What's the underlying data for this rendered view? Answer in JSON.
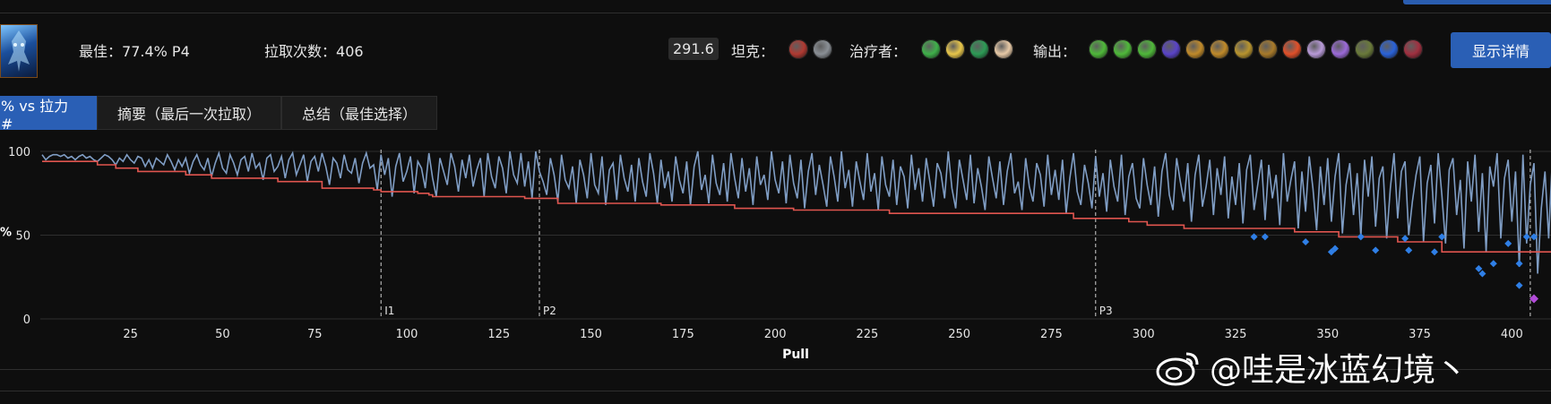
{
  "header": {
    "best_label": "最佳：",
    "best_value": "77.4% P4",
    "pulls_label": "拉取次数：",
    "pulls_value": "406",
    "score": "291.6",
    "tank_label": "坦克：",
    "healer_label": "治疗者：",
    "dps_label": "输出：",
    "detail_button": "显示详情",
    "tank_icons": [
      {
        "name": "tank-spec-icon-1",
        "color": "#b03a32"
      },
      {
        "name": "tank-spec-icon-2",
        "color": "#8a8f95"
      }
    ],
    "healer_icons": [
      {
        "name": "healer-spec-icon-1",
        "color": "#3fb04a"
      },
      {
        "name": "healer-spec-icon-2",
        "color": "#e8c64a"
      },
      {
        "name": "healer-spec-icon-3",
        "color": "#2d9a55"
      },
      {
        "name": "healer-spec-icon-4",
        "color": "#e7c9a6"
      }
    ],
    "dps_icons": [
      {
        "name": "dps-spec-icon-1",
        "color": "#4fb83a"
      },
      {
        "name": "dps-spec-icon-2",
        "color": "#4fb83a"
      },
      {
        "name": "dps-spec-icon-3",
        "color": "#4fb83a"
      },
      {
        "name": "dps-spec-icon-4",
        "color": "#5a44c8"
      },
      {
        "name": "dps-spec-icon-5",
        "color": "#c08a2a"
      },
      {
        "name": "dps-spec-icon-6",
        "color": "#c08a2a"
      },
      {
        "name": "dps-spec-icon-7",
        "color": "#b8942e"
      },
      {
        "name": "dps-spec-icon-8",
        "color": "#a87a2a"
      },
      {
        "name": "dps-spec-icon-9",
        "color": "#e0502a"
      },
      {
        "name": "dps-spec-icon-10",
        "color": "#b89ad8"
      },
      {
        "name": "dps-spec-icon-11",
        "color": "#9b6ad8"
      },
      {
        "name": "dps-spec-icon-12",
        "color": "#6a7a3a"
      },
      {
        "name": "dps-spec-icon-13",
        "color": "#2a62d8"
      },
      {
        "name": "dps-spec-icon-14",
        "color": "#a03040"
      }
    ]
  },
  "tabs": [
    {
      "label": "% vs 拉力 #",
      "active": true
    },
    {
      "label": "摘要（最后一次拉取）",
      "active": false
    },
    {
      "label": "总结（最佳选择）",
      "active": false
    }
  ],
  "watermark": "@哇是冰蓝幻境丶",
  "colors": {
    "accent": "#2a5fb5",
    "pull_line": "#7f9dc4",
    "best_line": "#e0554f",
    "marker_blue": "#2f7fe6",
    "marker_purple": "#b24bd8"
  },
  "chart_data": {
    "type": "line",
    "xlabel": "Pull",
    "ylabel": "%",
    "xlim": [
      1,
      406
    ],
    "ylim": [
      0,
      100
    ],
    "xticks": [
      25,
      50,
      75,
      100,
      125,
      150,
      175,
      200,
      225,
      250,
      275,
      300,
      325,
      350,
      375,
      400
    ],
    "yticks": [
      0,
      50,
      100
    ],
    "grid": "horizontal",
    "phase_markers": [
      {
        "label": "I1",
        "x": 93
      },
      {
        "label": "P2",
        "x": 136
      },
      {
        "label": "P3",
        "x": 287
      },
      {
        "label": "",
        "x": 405
      }
    ],
    "series": [
      {
        "values": [
          98,
          95,
          97,
          98,
          98,
          97,
          98,
          96,
          97,
          95,
          97,
          98,
          96,
          97,
          95,
          94,
          96,
          98,
          97,
          95,
          92,
          96,
          94,
          98,
          95,
          93,
          97,
          96,
          91,
          95,
          90,
          96,
          94,
          92,
          98,
          94,
          89,
          95,
          91,
          96,
          87,
          94,
          98,
          92,
          89,
          96,
          85,
          93,
          99,
          90,
          87,
          98,
          93,
          86,
          95,
          97,
          88,
          99,
          90,
          93,
          83,
          96,
          98,
          88,
          91,
          97,
          84,
          95,
          99,
          86,
          92,
          98,
          82,
          94,
          97,
          88,
          99,
          91,
          80,
          96,
          93,
          84,
          98,
          89,
          87,
          96,
          81,
          93,
          99,
          90,
          92,
          77,
          98,
          86,
          96,
          73,
          91,
          99,
          82,
          88,
          97,
          75,
          94,
          90,
          78,
          99,
          84,
          73,
          96,
          88,
          80,
          99,
          91,
          76,
          95,
          84,
          98,
          79,
          89,
          96,
          73,
          99,
          85,
          78,
          97,
          90,
          75,
          100,
          86,
          81,
          99,
          79,
          94,
          72,
          100,
          88,
          82,
          74,
          96,
          86,
          70,
          98,
          83,
          78,
          91,
          69,
          95,
          86,
          72,
          99,
          80,
          75,
          97,
          68,
          89,
          93,
          71,
          98,
          84,
          76,
          92,
          70,
          96,
          82,
          73,
          99,
          87,
          69,
          95,
          78,
          88,
          70,
          97,
          83,
          75,
          94,
          68,
          91,
          100,
          77,
          86,
          69,
          98,
          81,
          74,
          93,
          70,
          99,
          84,
          72,
          96,
          76,
          90,
          68,
          97,
          80,
          86,
          71,
          100,
          83,
          75,
          94,
          69,
          98,
          81,
          72,
          95,
          66,
          88,
          99,
          74,
          92,
          80,
          67,
          97,
          85,
          70,
          100,
          78,
          89,
          67,
          94,
          82,
          71,
          99,
          76,
          87,
          65,
          97,
          80,
          73,
          95,
          68,
          91,
          85,
          66,
          98,
          77,
          90,
          70,
          96,
          82,
          67,
          93,
          87,
          72,
          100,
          78,
          66,
          95,
          83,
          71,
          98,
          69,
          90,
          79,
          65,
          97,
          84,
          72,
          94,
          68,
          88,
          99,
          75,
          82,
          65,
          96,
          79,
          70,
          93,
          86,
          67,
          98,
          74,
          89,
          71,
          95,
          63,
          84,
          99,
          76,
          68,
          92,
          81,
          66,
          97,
          73,
          87,
          64,
          95,
          79,
          70,
          98,
          62,
          85,
          93,
          72,
          66,
          96,
          80,
          68,
          91,
          61,
          88,
          99,
          74,
          65,
          96,
          82,
          70,
          93,
          58,
          86,
          98,
          67,
          79,
          95,
          62,
          90,
          74,
          97,
          60,
          85,
          68,
          93,
          57,
          89,
          98,
          65,
          80,
          95,
          59,
          92,
          72,
          86,
          56,
          99,
          70,
          83,
          94,
          54,
          88,
          64,
          97,
          78,
          53,
          91,
          68,
          96,
          58,
          85,
          99,
          51,
          80,
          93,
          62,
          87,
          49,
          95,
          73,
          97,
          55,
          84,
          91,
          48,
          78,
          99,
          60,
          88,
          94,
          50,
          70,
          86,
          97,
          46,
          81,
          92,
          57,
          99,
          74,
          45,
          89,
          96,
          62,
          83,
          42,
          94,
          70,
          98,
          52,
          87,
          40,
          91,
          79,
          99,
          48,
          84,
          95,
          58,
          88,
          31,
          98,
          45,
          80,
          93,
          27,
          66,
          88,
          48,
          97,
          35,
          72,
          86,
          44,
          99,
          20,
          50,
          49,
          12,
          12,
          20,
          50,
          49,
          13,
          12
        ]
      },
      {
        "values": [
          94,
          94,
          94,
          94,
          94,
          94,
          94,
          94,
          94,
          94,
          94,
          94,
          94,
          94,
          94,
          92,
          92,
          92,
          92,
          92,
          90,
          90,
          90,
          90,
          90,
          90,
          88,
          88,
          88,
          88,
          88,
          88,
          88,
          88,
          88,
          88,
          88,
          88,
          88,
          86,
          86,
          86,
          86,
          86,
          86,
          86,
          84,
          84,
          84,
          84,
          84,
          84,
          84,
          84,
          84,
          84,
          84,
          84,
          84,
          84,
          84,
          84,
          84,
          84,
          82,
          82,
          82,
          82,
          82,
          82,
          82,
          82,
          82,
          82,
          82,
          82,
          78,
          78,
          78,
          78,
          78,
          78,
          78,
          78,
          78,
          78,
          78,
          78,
          78,
          78,
          77,
          77,
          76,
          76,
          76,
          76,
          76,
          76,
          76,
          76,
          76,
          76,
          75,
          75,
          75,
          74,
          73,
          73,
          73,
          73,
          73,
          73,
          73,
          73,
          73,
          73,
          73,
          73,
          73,
          73,
          73,
          73,
          73,
          73,
          73,
          73,
          73,
          73,
          73,
          73,
          73,
          72,
          72,
          72,
          72,
          72,
          72,
          72,
          72,
          72,
          69,
          69,
          69,
          69,
          69,
          69,
          69,
          69,
          69,
          69,
          69,
          69,
          69,
          69,
          69,
          69,
          69,
          69,
          69,
          69,
          69,
          69,
          69,
          69,
          69,
          69,
          69,
          69,
          68,
          68,
          68,
          68,
          68,
          68,
          68,
          68,
          68,
          68,
          68,
          68,
          68,
          68,
          68,
          68,
          68,
          68,
          68,
          68,
          66,
          66,
          66,
          66,
          66,
          66,
          66,
          66,
          66,
          66,
          66,
          66,
          66,
          66,
          66,
          66,
          65,
          65,
          65,
          65,
          65,
          65,
          65,
          65,
          65,
          65,
          65,
          65,
          65,
          65,
          65,
          65,
          65,
          65,
          65,
          65,
          65,
          65,
          65,
          65,
          65,
          65,
          63,
          63,
          63,
          63,
          63,
          63,
          63,
          63,
          63,
          63,
          63,
          63,
          63,
          63,
          63,
          63,
          63,
          63,
          63,
          63,
          63,
          63,
          63,
          63,
          63,
          63,
          63,
          63,
          63,
          63,
          63,
          63,
          63,
          63,
          63,
          63,
          63,
          63,
          63,
          63,
          63,
          63,
          63,
          63,
          63,
          63,
          63,
          63,
          63,
          63,
          60,
          60,
          60,
          60,
          60,
          60,
          60,
          60,
          60,
          60,
          60,
          60,
          60,
          60,
          60,
          58,
          58,
          58,
          58,
          58,
          56,
          56,
          56,
          56,
          56,
          56,
          56,
          56,
          56,
          56,
          54,
          54,
          54,
          54,
          54,
          54,
          54,
          54,
          54,
          54,
          54,
          54,
          54,
          54,
          54,
          54,
          54,
          54,
          54,
          54,
          54,
          54,
          54,
          54,
          54,
          54,
          54,
          54,
          54,
          54,
          52,
          52,
          52,
          52,
          52,
          52,
          52,
          52,
          52,
          52,
          52,
          52,
          49,
          49,
          49,
          49,
          49,
          49,
          49,
          49,
          49,
          49,
          49,
          49,
          49,
          49,
          49,
          49,
          46,
          46,
          46,
          46,
          46,
          46,
          46,
          46,
          46,
          46,
          46,
          46,
          40,
          40,
          40,
          40,
          40,
          40,
          40,
          40,
          40,
          40,
          40,
          40,
          40,
          40,
          40,
          40,
          40,
          40,
          40,
          40,
          40,
          40,
          40,
          40,
          40,
          40,
          40,
          40,
          40,
          40,
          40,
          40,
          40,
          40,
          40,
          40,
          40,
          40,
          40,
          40,
          27,
          27,
          27,
          27,
          27,
          27,
          27,
          27,
          27,
          27,
          27,
          27,
          27,
          20,
          12
        ]
      }
    ],
    "best_progress_points": [
      {
        "x": 330,
        "y": 49
      },
      {
        "x": 333,
        "y": 49
      },
      {
        "x": 344,
        "y": 46
      },
      {
        "x": 351,
        "y": 40
      },
      {
        "x": 352,
        "y": 42
      },
      {
        "x": 359,
        "y": 49
      },
      {
        "x": 363,
        "y": 41
      },
      {
        "x": 371,
        "y": 48
      },
      {
        "x": 372,
        "y": 41
      },
      {
        "x": 379,
        "y": 40
      },
      {
        "x": 381,
        "y": 49
      },
      {
        "x": 391,
        "y": 30
      },
      {
        "x": 392,
        "y": 27
      },
      {
        "x": 395,
        "y": 33
      },
      {
        "x": 399,
        "y": 45
      },
      {
        "x": 402,
        "y": 33
      },
      {
        "x": 404,
        "y": 49
      },
      {
        "x": 406,
        "y": 49
      },
      {
        "x": 402,
        "y": 20
      },
      {
        "x": 406,
        "y": 12
      }
    ],
    "final_point": {
      "x": 406,
      "y": 12
    }
  }
}
